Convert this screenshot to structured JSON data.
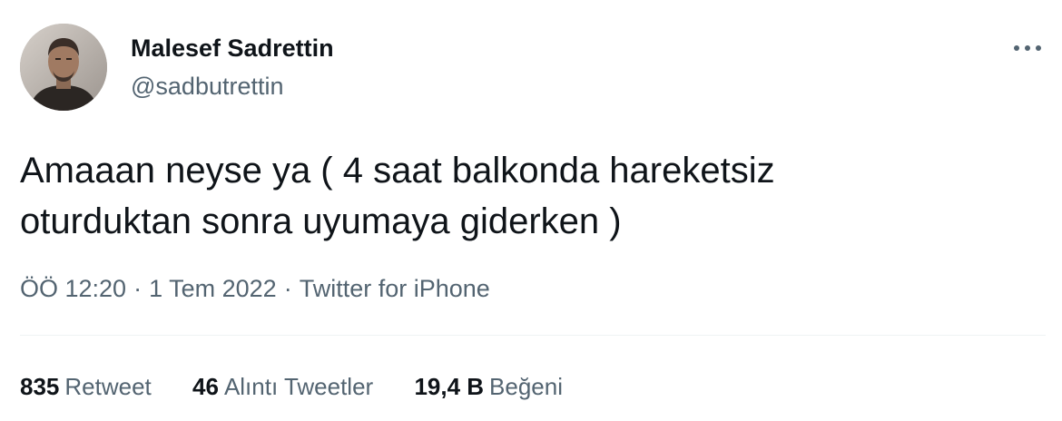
{
  "author": {
    "display_name": "Malesef Sadrettin",
    "handle": "@sadbutrettin"
  },
  "more_icon": "more-horizontal-icon",
  "tweet": {
    "text_lines": [
      "Amaaan neyse ya ( 4 saat balkonda hareketsiz",
      "oturduktan sonra uyumaya giderken )"
    ]
  },
  "meta": {
    "time": "ÖÖ 12:20",
    "separator": "·",
    "date": "1 Tem 2022",
    "source": "Twitter for iPhone"
  },
  "stats": {
    "retweets": {
      "count": "835",
      "label": "Retweet"
    },
    "quotes": {
      "count": "46",
      "label": "Alıntı Tweetler"
    },
    "likes": {
      "count": "19,4 B",
      "label": "Beğeni"
    }
  },
  "colors": {
    "primary_text": "#0f1419",
    "secondary_text": "#536471",
    "divider": "#eff3f4"
  }
}
